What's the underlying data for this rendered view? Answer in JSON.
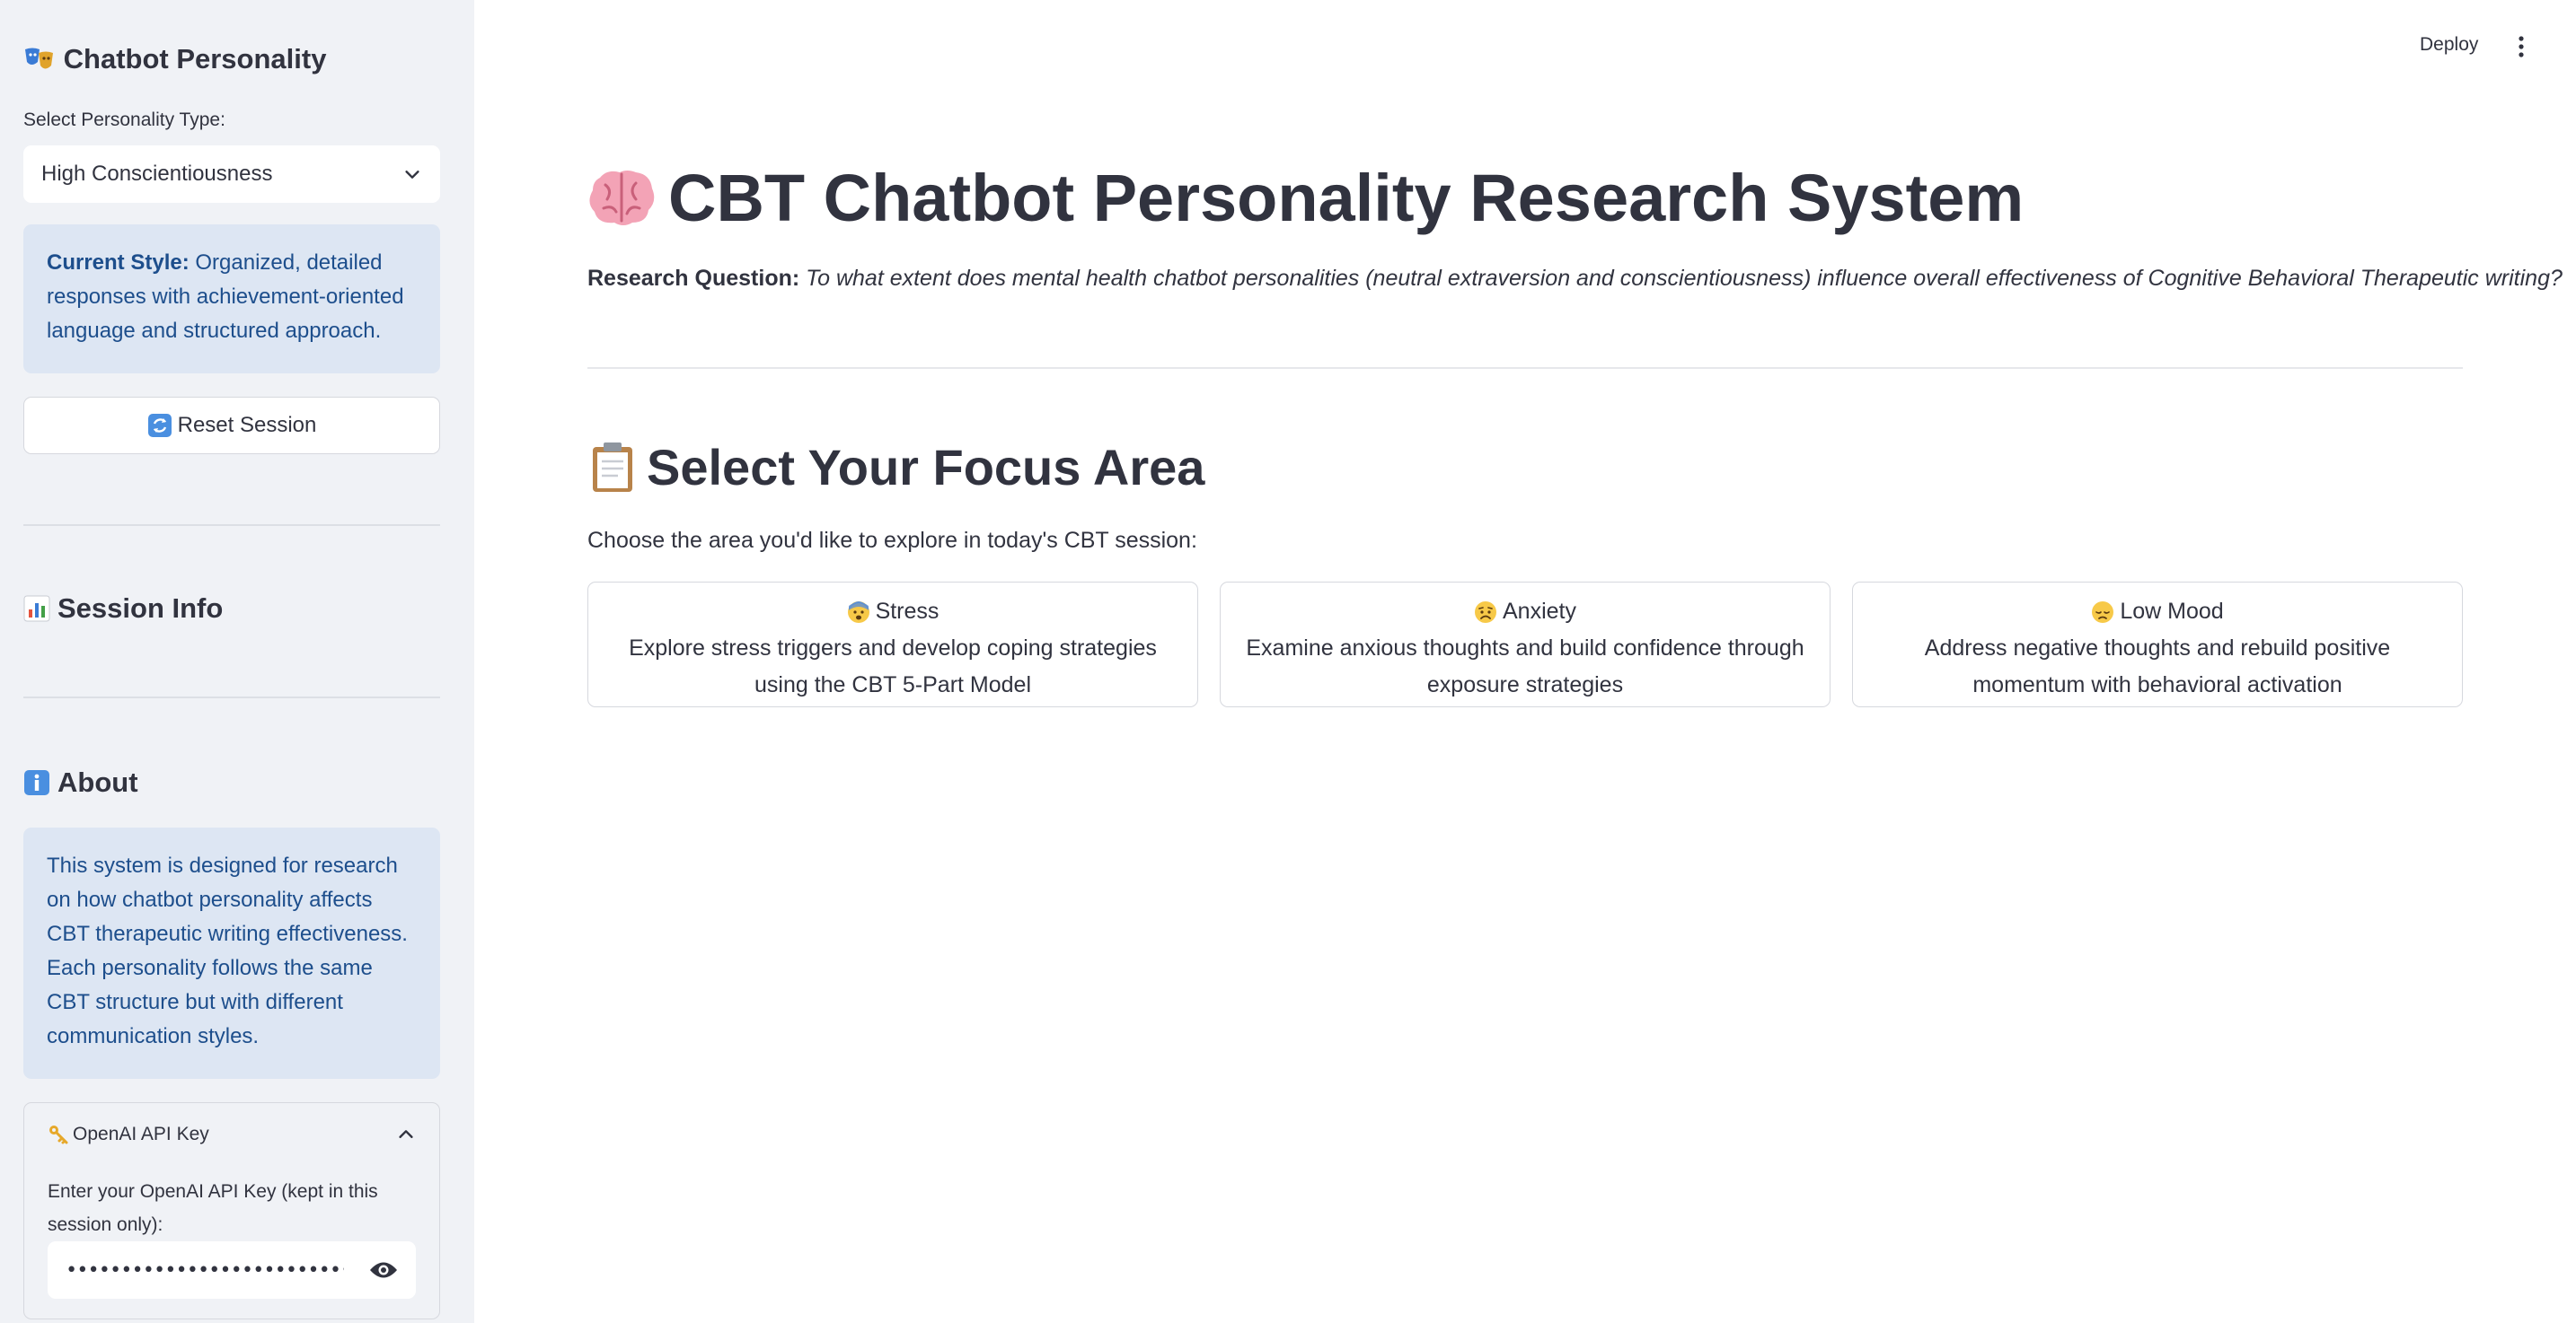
{
  "sidebar": {
    "title": "Chatbot Personality",
    "select_label": "Select Personality Type:",
    "selected_personality": "High Conscientiousness",
    "current_style_label": "Current Style:",
    "current_style_text": " Organized, detailed responses with achievement-oriented language and structured approach.",
    "reset_button": "Reset Session",
    "session_info_title": "Session Info",
    "about_title": "About",
    "about_text": "This system is designed for research on how chatbot personality affects CBT therapeutic writing effectiveness. Each personality follows the same CBT structure but with different communication styles.",
    "api_expander_title": "OpenAI API Key",
    "api_key_label": "Enter your OpenAI API Key (kept in this session only):",
    "api_key_value": "••••••••••••••••••••••••••••••••••••••••••"
  },
  "header": {
    "deploy_label": "Deploy"
  },
  "main": {
    "title": "CBT Chatbot Personality Research System",
    "research_question_label": "Research Question:",
    "research_question_text": " To what extent does mental health chatbot personalities (neutral extraversion and conscientiousness) influence overall effectiveness of Cognitive Behavioral Therapeutic writing?",
    "focus_title": "Select Your Focus Area",
    "focus_prompt": "Choose the area you'd like to explore in today's CBT session:",
    "cards": [
      {
        "title": "Stress",
        "description": "Explore stress triggers and develop coping strategies using the CBT 5-Part Model"
      },
      {
        "title": "Anxiety",
        "description": "Examine anxious thoughts and build confidence through exposure strategies"
      },
      {
        "title": "Low Mood",
        "description": "Address negative thoughts and rebuild positive momentum with behavioral activation"
      }
    ]
  },
  "icons": {
    "personality": "theater-masks-icon",
    "reset": "refresh-icon",
    "session_info": "bar-chart-icon",
    "about": "info-icon",
    "api_key": "key-icon",
    "title": "brain-icon",
    "focus": "clipboard-icon",
    "stress": "anxious-face-icon",
    "anxiety": "worried-face-icon",
    "low_mood": "pensive-face-icon"
  },
  "colors": {
    "sidebar_bg": "#f0f2f6",
    "info_bg": "#dde6f3",
    "info_text": "#1d4e8c",
    "text": "#31333f",
    "border": "#d6d8de"
  }
}
